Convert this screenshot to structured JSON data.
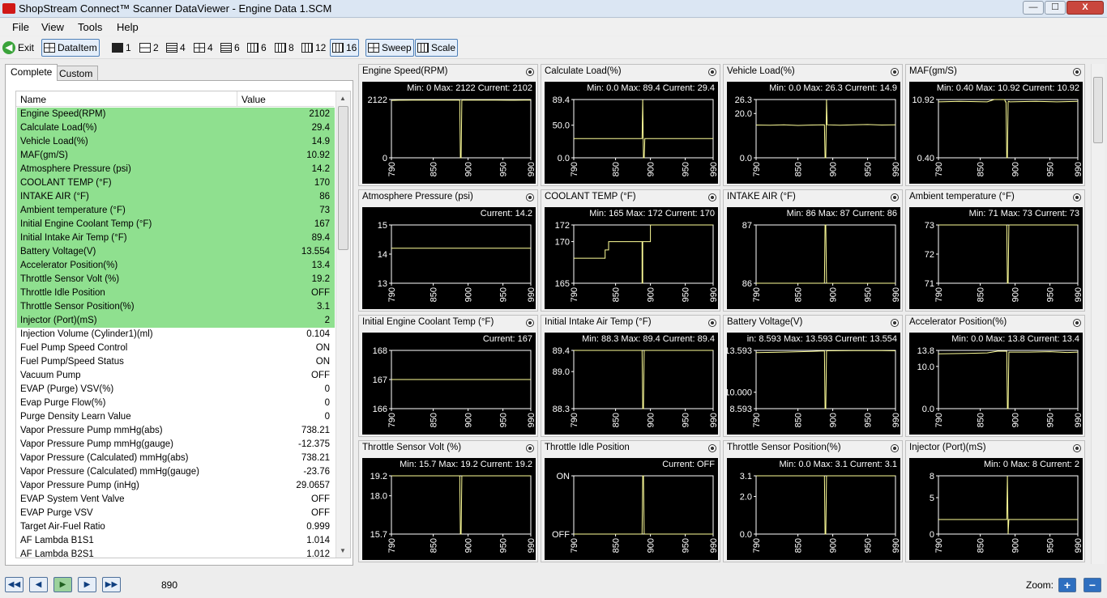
{
  "window": {
    "title": "ShopStream Connect™ Scanner DataViewer - Engine Data 1.SCM",
    "min": "—",
    "max": "☐",
    "close": "X"
  },
  "menu": [
    "File",
    "View",
    "Tools",
    "Help"
  ],
  "toolbar": {
    "exit": "Exit",
    "dataitem": "DataItem",
    "layouts": [
      "1",
      "2",
      "4",
      "4",
      "6",
      "6",
      "8",
      "12",
      "16"
    ],
    "sweep": "Sweep",
    "scale": "Scale"
  },
  "tabs": [
    "Complete",
    "Custom"
  ],
  "list": {
    "columns": [
      "Name",
      "Value"
    ],
    "rows": [
      {
        "name": "Engine Speed(RPM)",
        "value": "2102",
        "highlight": true
      },
      {
        "name": "Calculate Load(%)",
        "value": "29.4",
        "highlight": true
      },
      {
        "name": "Vehicle Load(%)",
        "value": "14.9",
        "highlight": true
      },
      {
        "name": "MAF(gm/S)",
        "value": "10.92",
        "highlight": true
      },
      {
        "name": "Atmosphere Pressure (psi)",
        "value": "14.2",
        "highlight": true
      },
      {
        "name": "COOLANT TEMP (°F)",
        "value": "170",
        "highlight": true
      },
      {
        "name": "INTAKE AIR (°F)",
        "value": "86",
        "highlight": true
      },
      {
        "name": "Ambient temperature (°F)",
        "value": "73",
        "highlight": true
      },
      {
        "name": "Initial Engine Coolant Temp (°F)",
        "value": "167",
        "highlight": true
      },
      {
        "name": "Initial Intake Air Temp (°F)",
        "value": "89.4",
        "highlight": true
      },
      {
        "name": "Battery Voltage(V)",
        "value": "13.554",
        "highlight": true
      },
      {
        "name": "Accelerator Position(%)",
        "value": "13.4",
        "highlight": true
      },
      {
        "name": "Throttle Sensor Volt (%)",
        "value": "19.2",
        "highlight": true
      },
      {
        "name": "Throttle Idle Position",
        "value": "OFF",
        "highlight": true
      },
      {
        "name": "Throttle Sensor Position(%)",
        "value": "3.1",
        "highlight": true
      },
      {
        "name": "Injector (Port)(mS)",
        "value": "2",
        "highlight": true
      },
      {
        "name": "Injection Volume (Cylinder1)(ml)",
        "value": "0.104",
        "highlight": false
      },
      {
        "name": "Fuel Pump Speed Control",
        "value": "ON",
        "highlight": false
      },
      {
        "name": "Fuel Pump/Speed Status",
        "value": "ON",
        "highlight": false
      },
      {
        "name": "Vacuum Pump",
        "value": "OFF",
        "highlight": false
      },
      {
        "name": "EVAP (Purge) VSV(%)",
        "value": "0",
        "highlight": false
      },
      {
        "name": "Evap Purge Flow(%)",
        "value": "0",
        "highlight": false
      },
      {
        "name": "Purge Density Learn Value",
        "value": "0",
        "highlight": false
      },
      {
        "name": "Vapor Pressure Pump mmHg(abs)",
        "value": "738.21",
        "highlight": false
      },
      {
        "name": "Vapor Pressure Pump mmHg(gauge)",
        "value": "-12.375",
        "highlight": false
      },
      {
        "name": "Vapor Pressure (Calculated) mmHg(abs)",
        "value": "738.21",
        "highlight": false
      },
      {
        "name": "Vapor Pressure (Calculated) mmHg(gauge)",
        "value": "-23.76",
        "highlight": false
      },
      {
        "name": "Vapor Pressure Pump (inHg)",
        "value": "29.0657",
        "highlight": false
      },
      {
        "name": "EVAP System Vent Valve",
        "value": "OFF",
        "highlight": false
      },
      {
        "name": "EVAP Purge VSV",
        "value": "OFF",
        "highlight": false
      },
      {
        "name": "Target Air-Fuel Ratio",
        "value": "0.999",
        "highlight": false
      },
      {
        "name": "AF Lambda B1S1",
        "value": "1.014",
        "highlight": false
      },
      {
        "name": "AF Lambda B2S1",
        "value": "1.012",
        "highlight": false
      }
    ]
  },
  "chart_data": [
    {
      "type": "line",
      "title": "Engine Speed(RPM)",
      "stats": "Min: 0    Max: 2122    Current: 2102",
      "x": [
        790,
        850,
        900,
        950,
        990
      ],
      "xticks": [
        "790",
        "850",
        "900",
        "950",
        "990"
      ],
      "ylim": [
        0,
        2122
      ],
      "yticks": [
        {
          "v": 2122,
          "l": "2122"
        },
        {
          "v": 0,
          "l": "0"
        }
      ],
      "series": [
        {
          "x": [
            790,
            800,
            820,
            840,
            860,
            880,
            888,
            889,
            890,
            891,
            892,
            900,
            920,
            940,
            960,
            980,
            990
          ],
          "y": [
            2090,
            2095,
            2100,
            2098,
            2102,
            2100,
            2100,
            0,
            0,
            2105,
            2100,
            2098,
            2102,
            2100,
            2096,
            2102,
            2102
          ]
        }
      ]
    },
    {
      "type": "line",
      "title": "Calculate Load(%)",
      "stats": "Min: 0.0    Max: 89.4    Current: 29.4",
      "x": [
        790,
        850,
        900,
        950,
        990
      ],
      "xticks": [
        "790",
        "850",
        "900",
        "950",
        "990"
      ],
      "ylim": [
        0,
        89.4
      ],
      "yticks": [
        {
          "v": 89.4,
          "l": "89.4"
        },
        {
          "v": 50,
          "l": "50.0"
        },
        {
          "v": 0,
          "l": "0.0"
        }
      ],
      "series": [
        {
          "x": [
            790,
            888,
            889,
            890,
            891,
            892,
            990
          ],
          "y": [
            29.6,
            29.5,
            89.4,
            0,
            0,
            29.4,
            29.4
          ]
        }
      ]
    },
    {
      "type": "line",
      "title": "Vehicle Load(%)",
      "stats": "Min: 0.0    Max: 26.3    Current: 14.9",
      "x": [
        790,
        850,
        900,
        950,
        990
      ],
      "xticks": [
        "790",
        "850",
        "900",
        "950",
        "990"
      ],
      "ylim": [
        0,
        26.3
      ],
      "yticks": [
        {
          "v": 26.3,
          "l": "26.3"
        },
        {
          "v": 20,
          "l": "20.0"
        },
        {
          "v": 0,
          "l": "0.0"
        }
      ],
      "series": [
        {
          "x": [
            790,
            810,
            830,
            850,
            870,
            888,
            889,
            890,
            891,
            892,
            910,
            930,
            950,
            970,
            990
          ],
          "y": [
            14.8,
            14.7,
            14.9,
            14.6,
            14.8,
            14.9,
            0,
            0,
            26.3,
            14.9,
            14.7,
            14.9,
            15.0,
            14.8,
            14.9
          ]
        }
      ]
    },
    {
      "type": "line",
      "title": "MAF(gm/S)",
      "stats": "Min: 0.40    Max: 10.92    Current: 10.92",
      "x": [
        790,
        850,
        900,
        950,
        990
      ],
      "xticks": [
        "790",
        "850",
        "900",
        "950",
        "990"
      ],
      "ylim": [
        0.4,
        10.92
      ],
      "yticks": [
        {
          "v": 10.92,
          "l": "10.92"
        },
        {
          "v": 0.4,
          "l": "0.40"
        }
      ],
      "series": [
        {
          "x": [
            790,
            820,
            860,
            870,
            885,
            886,
            887,
            888,
            889,
            890,
            891,
            892,
            930,
            960,
            990
          ],
          "y": [
            10.5,
            10.6,
            10.5,
            10.92,
            10.92,
            10.5,
            10.5,
            0.4,
            0.4,
            10.5,
            10.6,
            10.5,
            10.6,
            10.5,
            10.6
          ]
        }
      ]
    },
    {
      "type": "line",
      "title": "Atmosphere Pressure (psi)",
      "stats": "Current: 14.2",
      "x": [
        790,
        850,
        900,
        950,
        990
      ],
      "xticks": [
        "790",
        "850",
        "900",
        "950",
        "990"
      ],
      "ylim": [
        13,
        15
      ],
      "yticks": [
        {
          "v": 15,
          "l": "15"
        },
        {
          "v": 14,
          "l": "14"
        },
        {
          "v": 13,
          "l": "13"
        }
      ],
      "series": [
        {
          "x": [
            790,
            990
          ],
          "y": [
            14.2,
            14.2
          ]
        }
      ]
    },
    {
      "type": "line",
      "title": "COOLANT TEMP (°F)",
      "stats": "Min: 165    Max: 172    Current: 170",
      "x": [
        790,
        850,
        900,
        950,
        990
      ],
      "xticks": [
        "790",
        "850",
        "900",
        "950",
        "990"
      ],
      "ylim": [
        165,
        172
      ],
      "yticks": [
        {
          "v": 172,
          "l": "172"
        },
        {
          "v": 170,
          "l": "170"
        },
        {
          "v": 165,
          "l": "165"
        }
      ],
      "series": [
        {
          "x": [
            790,
            835,
            835,
            840,
            840,
            888,
            888,
            889,
            889,
            900,
            900,
            990
          ],
          "y": [
            168,
            168,
            169,
            169,
            170,
            170,
            165,
            165,
            170,
            170,
            172,
            172
          ]
        }
      ]
    },
    {
      "type": "line",
      "title": "INTAKE AIR (°F)",
      "stats": "Min: 86    Max: 87    Current: 86",
      "x": [
        790,
        850,
        900,
        950,
        990
      ],
      "xticks": [
        "790",
        "850",
        "900",
        "950",
        "990"
      ],
      "ylim": [
        86,
        87
      ],
      "yticks": [
        {
          "v": 87,
          "l": "87"
        },
        {
          "v": 86,
          "l": "86"
        }
      ],
      "series": [
        {
          "x": [
            790,
            888,
            889,
            890,
            891,
            990
          ],
          "y": [
            86,
            86,
            87,
            87,
            86,
            86
          ]
        }
      ]
    },
    {
      "type": "line",
      "title": "Ambient temperature (°F)",
      "stats": "Min: 71    Max: 73    Current: 73",
      "x": [
        790,
        850,
        900,
        950,
        990
      ],
      "xticks": [
        "790",
        "850",
        "900",
        "950",
        "990"
      ],
      "ylim": [
        71,
        73
      ],
      "yticks": [
        {
          "v": 73,
          "l": "73"
        },
        {
          "v": 72,
          "l": "72"
        },
        {
          "v": 71,
          "l": "71"
        }
      ],
      "series": [
        {
          "x": [
            790,
            888,
            889,
            890,
            891,
            990
          ],
          "y": [
            73,
            73,
            71,
            71,
            73,
            73
          ]
        }
      ]
    },
    {
      "type": "line",
      "title": "Initial Engine Coolant Temp (°F)",
      "stats": "Current: 167",
      "x": [
        790,
        850,
        900,
        950,
        990
      ],
      "xticks": [
        "790",
        "850",
        "900",
        "950",
        "990"
      ],
      "ylim": [
        166,
        168
      ],
      "yticks": [
        {
          "v": 168,
          "l": "168"
        },
        {
          "v": 167,
          "l": "167"
        },
        {
          "v": 166,
          "l": "166"
        }
      ],
      "series": [
        {
          "x": [
            790,
            990
          ],
          "y": [
            167,
            167
          ]
        }
      ]
    },
    {
      "type": "line",
      "title": "Initial Intake Air Temp (°F)",
      "stats": "Min: 88.3    Max: 89.4    Current: 89.4",
      "x": [
        790,
        850,
        900,
        950,
        990
      ],
      "xticks": [
        "790",
        "850",
        "900",
        "950",
        "990"
      ],
      "ylim": [
        88.3,
        89.4
      ],
      "yticks": [
        {
          "v": 89.4,
          "l": "89.4"
        },
        {
          "v": 89.0,
          "l": "89.0"
        },
        {
          "v": 88.3,
          "l": "88.3"
        }
      ],
      "series": [
        {
          "x": [
            790,
            888,
            889,
            890,
            891,
            990
          ],
          "y": [
            89.4,
            89.4,
            88.3,
            88.3,
            89.4,
            89.4
          ]
        }
      ]
    },
    {
      "type": "line",
      "title": "Battery Voltage(V)",
      "stats": "in: 8.593    Max: 13.593    Current: 13.554",
      "x": [
        790,
        850,
        900,
        950,
        990
      ],
      "xticks": [
        "790",
        "850",
        "900",
        "950",
        "990"
      ],
      "ylim": [
        8.593,
        13.593
      ],
      "yticks": [
        {
          "v": 13.593,
          "l": "13.593"
        },
        {
          "v": 10,
          "l": "10.000"
        },
        {
          "v": 8.593,
          "l": "8.593"
        }
      ],
      "series": [
        {
          "x": [
            790,
            830,
            870,
            888,
            889,
            890,
            891,
            930,
            970,
            990
          ],
          "y": [
            13.4,
            13.45,
            13.5,
            13.55,
            8.593,
            8.593,
            13.56,
            13.58,
            13.57,
            13.56
          ]
        }
      ]
    },
    {
      "type": "line",
      "title": "Accelerator Position(%)",
      "stats": "Min: 0.0    Max: 13.8    Current: 13.4",
      "x": [
        790,
        850,
        900,
        950,
        990
      ],
      "xticks": [
        "790",
        "850",
        "900",
        "950",
        "990"
      ],
      "ylim": [
        0,
        13.8
      ],
      "yticks": [
        {
          "v": 13.8,
          "l": "13.8"
        },
        {
          "v": 10,
          "l": "10.0"
        },
        {
          "v": 0,
          "l": "0.0"
        }
      ],
      "series": [
        {
          "x": [
            790,
            830,
            860,
            875,
            888,
            889,
            890,
            891,
            920,
            950,
            975,
            990
          ],
          "y": [
            13.0,
            13.1,
            13.2,
            13.6,
            13.6,
            0,
            0,
            13.4,
            13.4,
            13.5,
            13.3,
            13.4
          ]
        }
      ]
    },
    {
      "type": "line",
      "title": "Throttle Sensor Volt (%)",
      "stats": "Min: 15.7    Max: 19.2    Current: 19.2",
      "x": [
        790,
        850,
        900,
        950,
        990
      ],
      "xticks": [
        "790",
        "850",
        "900",
        "950",
        "990"
      ],
      "ylim": [
        15.7,
        19.2
      ],
      "yticks": [
        {
          "v": 19.2,
          "l": "19.2"
        },
        {
          "v": 18,
          "l": "18.0"
        },
        {
          "v": 15.7,
          "l": "15.7"
        }
      ],
      "series": [
        {
          "x": [
            790,
            888,
            889,
            890,
            891,
            990
          ],
          "y": [
            19.2,
            19.2,
            15.7,
            15.7,
            19.2,
            19.2
          ]
        }
      ]
    },
    {
      "type": "line",
      "title": "Throttle Idle Position",
      "stats": "Current: OFF",
      "x": [
        790,
        850,
        900,
        950,
        990
      ],
      "xticks": [
        "790",
        "850",
        "900",
        "950",
        "990"
      ],
      "ylim": [
        0,
        1
      ],
      "yticks": [
        {
          "v": 1,
          "l": "ON"
        },
        {
          "v": 0,
          "l": "OFF"
        }
      ],
      "series": [
        {
          "x": [
            790,
            888,
            889,
            890,
            891,
            990
          ],
          "y": [
            0,
            0,
            1,
            1,
            0,
            0
          ]
        }
      ]
    },
    {
      "type": "line",
      "title": "Throttle Sensor Position(%)",
      "stats": "Min: 0.0    Max: 3.1    Current: 3.1",
      "x": [
        790,
        850,
        900,
        950,
        990
      ],
      "xticks": [
        "790",
        "850",
        "900",
        "950",
        "990"
      ],
      "ylim": [
        0,
        3.1
      ],
      "yticks": [
        {
          "v": 3.1,
          "l": "3.1"
        },
        {
          "v": 2,
          "l": "2.0"
        },
        {
          "v": 0,
          "l": "0.0"
        }
      ],
      "series": [
        {
          "x": [
            790,
            888,
            889,
            890,
            891,
            990
          ],
          "y": [
            3.1,
            3.1,
            0,
            0,
            3.1,
            3.1
          ]
        }
      ]
    },
    {
      "type": "line",
      "title": "Injector (Port)(mS)",
      "stats": "Min: 0    Max: 8    Current: 2",
      "x": [
        790,
        850,
        900,
        950,
        990
      ],
      "xticks": [
        "790",
        "850",
        "900",
        "950",
        "990"
      ],
      "ylim": [
        0,
        8
      ],
      "yticks": [
        {
          "v": 8,
          "l": "8"
        },
        {
          "v": 5,
          "l": "5"
        },
        {
          "v": 0,
          "l": "0"
        }
      ],
      "series": [
        {
          "x": [
            790,
            888,
            889,
            890,
            891,
            990
          ],
          "y": [
            2,
            2,
            8,
            0,
            2,
            2
          ]
        }
      ]
    }
  ],
  "bottom": {
    "frame": "890",
    "zoom_label": "Zoom:",
    "zoom_in": "+",
    "zoom_out": "−"
  },
  "colors": {
    "highlight": "#8fe08f",
    "plot_bg": "#000000",
    "trace": "#ffff99"
  }
}
